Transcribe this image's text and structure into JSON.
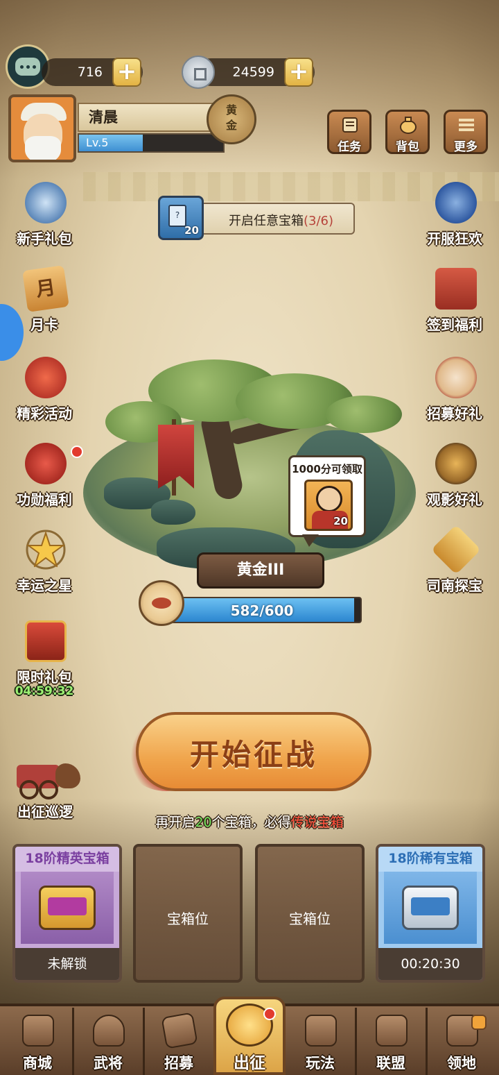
{
  "currency": {
    "gems": "716",
    "coins": "24599"
  },
  "profile": {
    "name": "清晨",
    "level": "Lv.5",
    "level_progress": 0.44,
    "rank_badge": "黄金"
  },
  "top_buttons": [
    {
      "label": "任务",
      "icon": "scroll-icon"
    },
    {
      "label": "背包",
      "icon": "bag-icon"
    },
    {
      "label": "更多",
      "icon": "menu-icon"
    }
  ],
  "chest_task": {
    "count": "20",
    "text": "开启任意宝箱",
    "progress": "(3/6)"
  },
  "left_side": [
    {
      "label": "新手礼包",
      "icon": "newbie-gift-icon"
    },
    {
      "label": "月卡",
      "icon": "month-card-icon"
    },
    {
      "label": "精彩活动",
      "icon": "events-icon"
    },
    {
      "label": "功勋福利",
      "icon": "merit-bag-icon"
    },
    {
      "label": "幸运之星",
      "icon": "lucky-star-icon"
    },
    {
      "label": "限时礼包",
      "icon": "limited-chest-icon",
      "timer": "04:59:32"
    },
    {
      "label": "出征巡逻",
      "icon": "patrol-chariot-icon"
    }
  ],
  "right_side": [
    {
      "label": "开服狂欢",
      "icon": "server-carnival-icon"
    },
    {
      "label": "签到福利",
      "icon": "sign-in-icon"
    },
    {
      "label": "招募好礼",
      "icon": "recruit-drum-icon"
    },
    {
      "label": "观影好礼",
      "icon": "watch-video-icon"
    },
    {
      "label": "司南探宝",
      "icon": "compass-treasure-icon"
    }
  ],
  "reward_bubble": {
    "title": "1000分可领取",
    "count": "20"
  },
  "rank": {
    "name": "黄金III",
    "exp": "582/600",
    "exp_fraction": 0.97
  },
  "battle": {
    "label": "开始征战"
  },
  "hint": {
    "pre": "再开启",
    "num": "20",
    "mid": "个宝箱，必得",
    "target": "传说宝箱"
  },
  "slots": [
    {
      "title": "18阶精英宝箱",
      "footer": "未解锁"
    },
    {
      "label": "宝箱位"
    },
    {
      "label": "宝箱位"
    },
    {
      "title": "18阶稀有宝箱",
      "footer": "00:20:30"
    }
  ],
  "nav": [
    {
      "label": "商城",
      "icon": "shop-icon"
    },
    {
      "label": "武将",
      "icon": "general-helmet-icon"
    },
    {
      "label": "招募",
      "icon": "recruit-scroll-icon"
    },
    {
      "label": "出征",
      "icon": "battle-gong-icon"
    },
    {
      "label": "玩法",
      "icon": "pavilion-icon"
    },
    {
      "label": "联盟",
      "icon": "alliance-flag-icon"
    },
    {
      "label": "领地",
      "icon": "territory-icon"
    }
  ],
  "colors": {
    "accent_gold": "#e3b344",
    "exp_blue": "#2b86cf",
    "hint_green": "#6ee05a",
    "hint_red": "#ff4d3a"
  }
}
